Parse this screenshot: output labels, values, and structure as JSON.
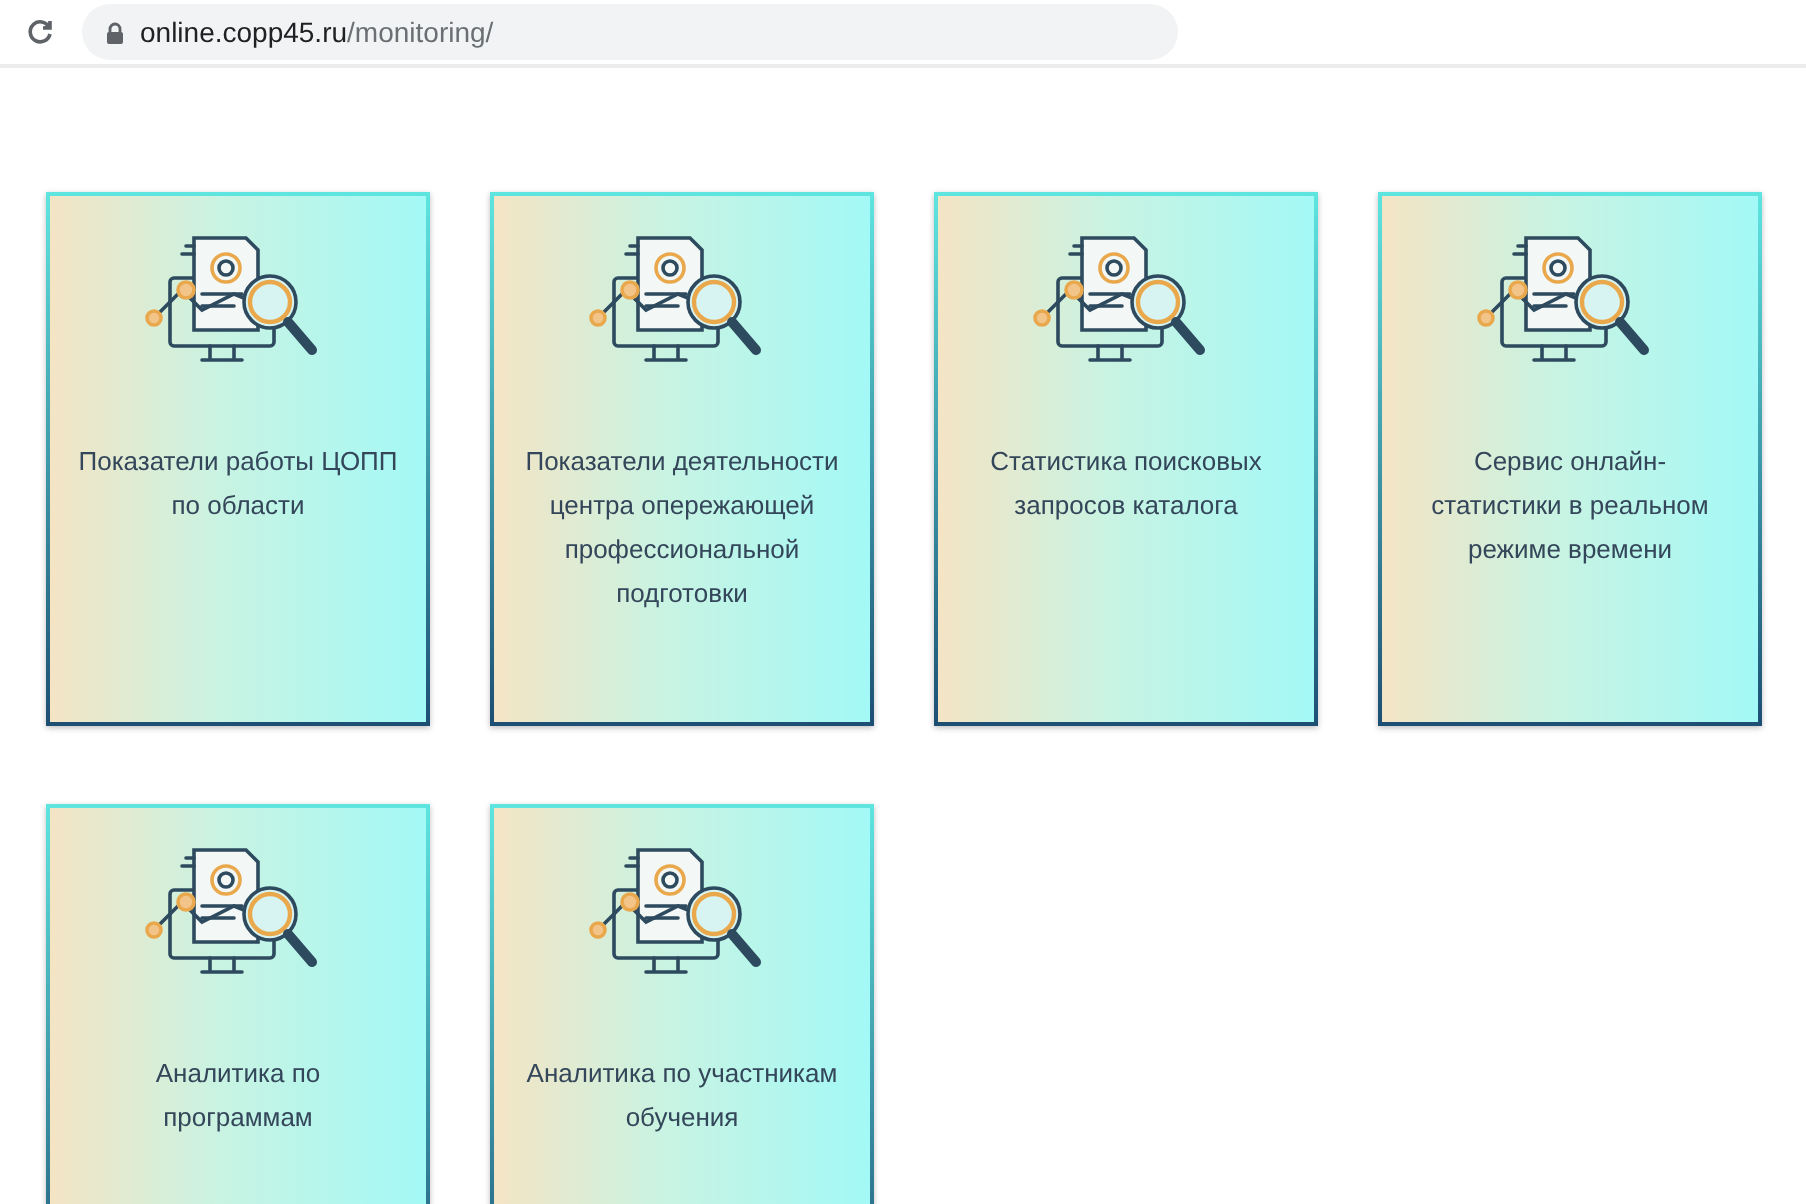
{
  "address_bar": {
    "host": "online.copp45.ru",
    "path": "/monitoring/"
  },
  "cards": [
    {
      "title": "Показатели работы ЦОПП по области"
    },
    {
      "title": "Показатели деятельности центра опережающей профессиональной подготовки"
    },
    {
      "title": "Статистика поисковых запросов каталога"
    },
    {
      "title": "Сервис онлайн-статистики в реальном режиме времени"
    },
    {
      "title": "Аналитика по программам"
    },
    {
      "title": "Аналитика по участникам обучения"
    }
  ]
}
